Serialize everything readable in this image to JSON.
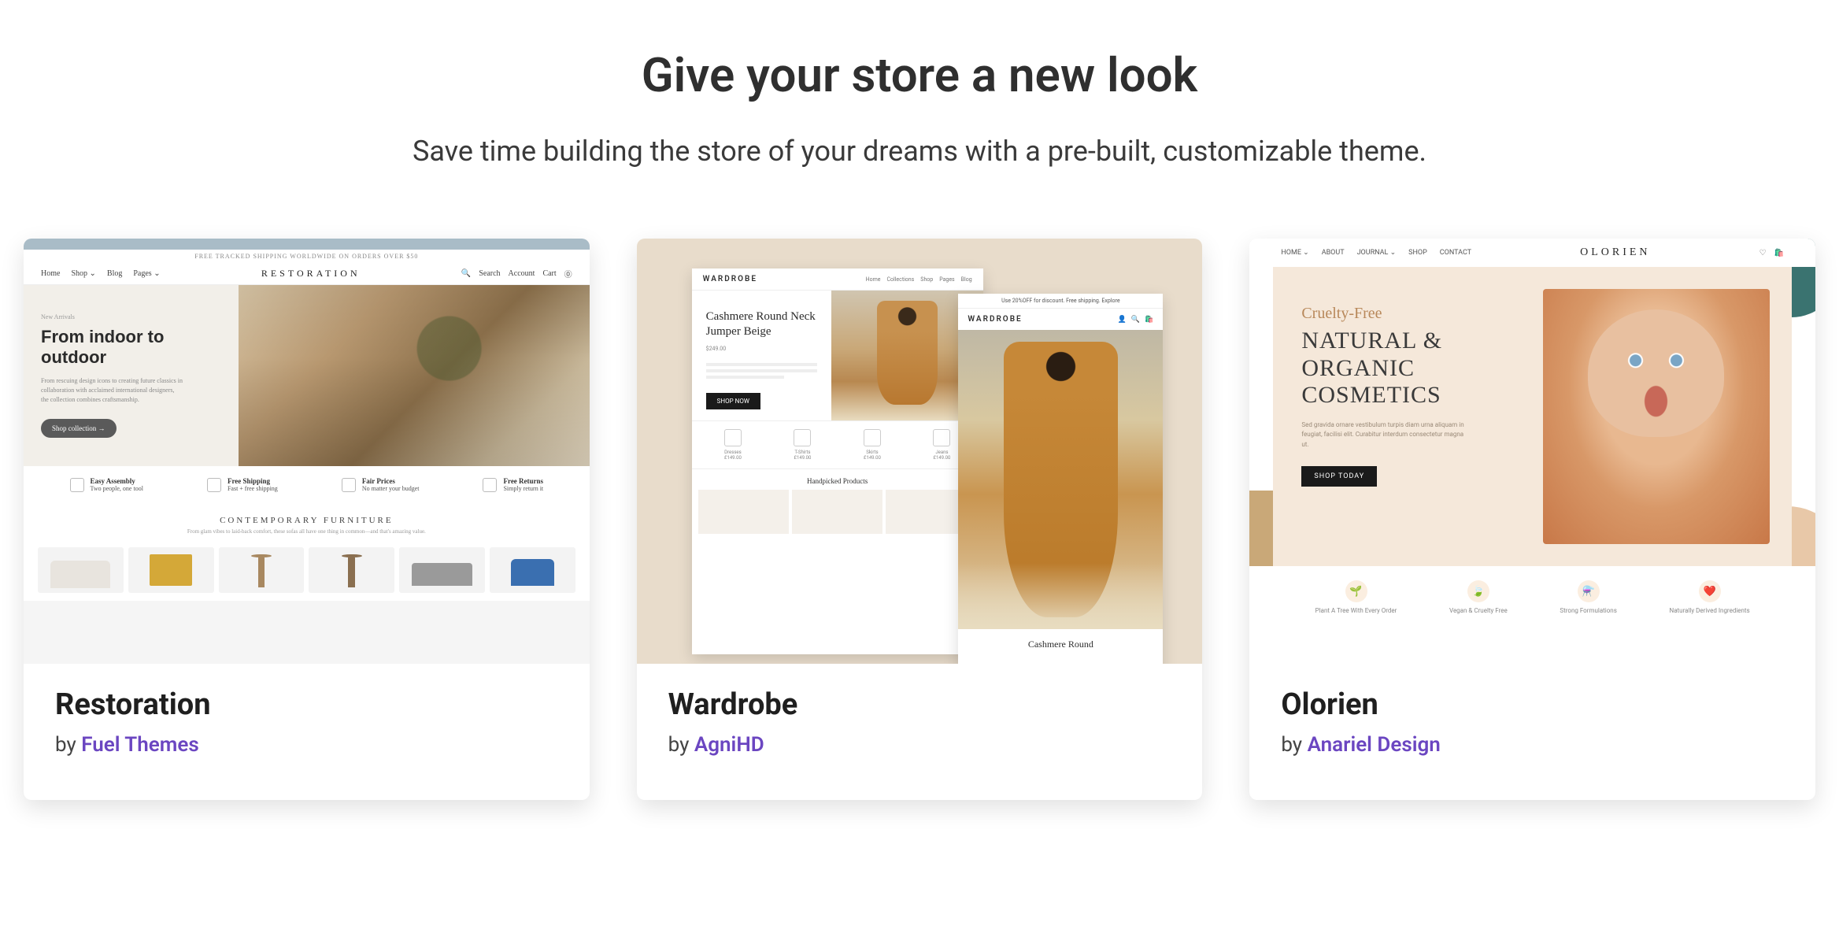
{
  "heading": "Give your store a new look",
  "subheading": "Save time building the store of your dreams with a pre-built, customizable theme.",
  "by_prefix": "by ",
  "themes": [
    {
      "title": "Restoration",
      "author": "Fuel Themes"
    },
    {
      "title": "Wardrobe",
      "author": "AgniHD"
    },
    {
      "title": "Olorien",
      "author": "Anariel Design"
    }
  ],
  "restoration": {
    "promo": "FREE TRACKED SHIPPING WORLDWIDE ON ORDERS OVER $50",
    "nav_left": [
      "Home",
      "Shop ⌄",
      "Blog",
      "Pages ⌄"
    ],
    "logo": "RESTORATION",
    "nav_right": [
      "Search",
      "Account",
      "Cart"
    ],
    "eyebrow": "New Arrivals",
    "hero_title": "From indoor to outdoor",
    "hero_desc": "From rescuing design icons to creating future classics in collaboration with acclaimed international designers, the collection combines craftsmanship.",
    "hero_btn": "Shop collection  →",
    "features": [
      {
        "title": "Easy Assembly",
        "sub": "Two people, one tool"
      },
      {
        "title": "Free Shipping",
        "sub": "Fast + free shipping"
      },
      {
        "title": "Fair Prices",
        "sub": "No matter your budget"
      },
      {
        "title": "Free Returns",
        "sub": "Simply return it"
      }
    ],
    "cat_title": "CONTEMPORARY FURNITURE",
    "cat_sub": "From glam vibes to laid-back comfort, these sofas all have one thing in common—and that's amazing value."
  },
  "wardrobe": {
    "logo": "WARDROBE",
    "nav": [
      "Home",
      "Collections",
      "Shop",
      "Pages",
      "Blog"
    ],
    "product_title": "Cashmere Round Neck Jumper Beige",
    "price": "$249.00",
    "btn": "SHOP NOW",
    "cats": [
      "Dresses",
      "T-Shirts",
      "Skirts",
      "Jeans"
    ],
    "prices_row": "£149.00",
    "handpicked": "Handpicked Products",
    "right_bar": "Use 20%OFF for discount. Free shipping. Explore",
    "right_caption": "Cashmere Round"
  },
  "olorien": {
    "nav_left": [
      "HOME ⌄",
      "ABOUT",
      "JOURNAL ⌄",
      "SHOP",
      "CONTACT"
    ],
    "logo": "OLORIEN",
    "script": "Cruelty-Free",
    "hero_title_1": "NATURAL &",
    "hero_title_2": "ORGANIC",
    "hero_title_3": "COSMETICS",
    "hero_desc": "Sed gravida ornare vestibulum turpis diam urna aliquam in feugiat, facilisi elit. Curabitur interdum consectetur magna ut.",
    "hero_btn": "SHOP TODAY",
    "badges": [
      {
        "icon": "🌱",
        "label": "Plant A Tree With Every Order"
      },
      {
        "icon": "🍃",
        "label": "Vegan & Cruelty Free"
      },
      {
        "icon": "⚗️",
        "label": "Strong Formulations"
      },
      {
        "icon": "❤️",
        "label": "Naturally Derived Ingredients"
      }
    ]
  }
}
